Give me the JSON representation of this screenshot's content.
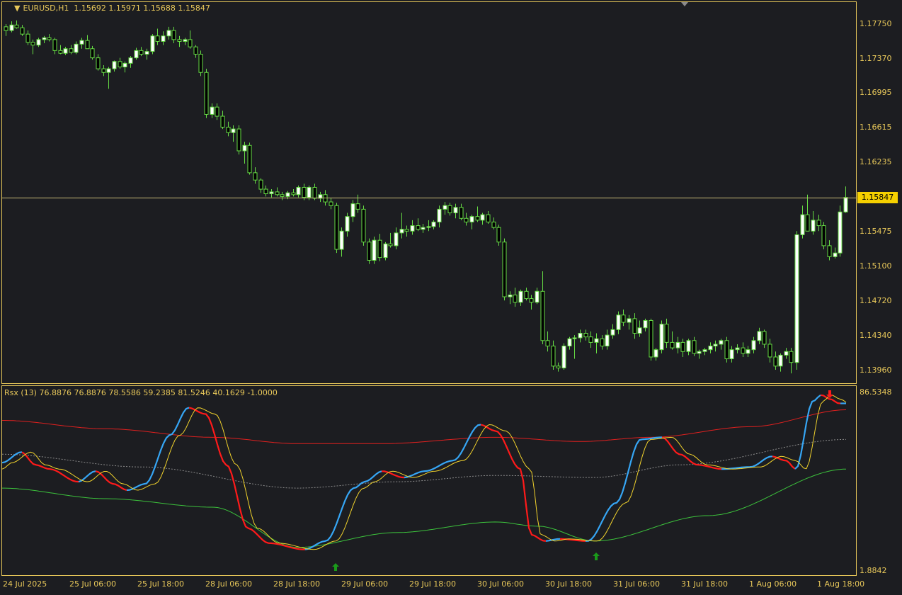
{
  "main": {
    "symbol_timeframe": "EURUSD,H1",
    "ohlc": "1.15692 1.15971 1.15688 1.15847",
    "price_labels": [
      "1.17750",
      "1.17370",
      "1.16995",
      "1.16615",
      "1.16235",
      "1.15475",
      "1.15100",
      "1.14720",
      "1.14340",
      "1.13960"
    ],
    "bid_price": "1.15847"
  },
  "indicator": {
    "title": "Rsx (13) 76.8876 76.8876 78.5586 59.2385 81.5246 40.1629 -1.0000",
    "scale_top": "86.5348",
    "scale_bottom": "1.8842"
  },
  "time_labels": [
    "24 Jul 2025",
    "25 Jul 06:00",
    "25 Jul 18:00",
    "28 Jul 06:00",
    "28 Jul 18:00",
    "29 Jul 06:00",
    "29 Jul 18:00",
    "30 Jul 06:00",
    "30 Jul 18:00",
    "31 Jul 06:00",
    "31 Jul 18:00",
    "1 Aug 06:00",
    "1 Aug 18:00"
  ],
  "colors": {
    "background": "#1c1d21",
    "frame": "#e8c85a",
    "candle": "#66dd44",
    "bull_fill": "#ffffff",
    "bear_fill": "#000000",
    "rsx_up": "#36a6f5",
    "rsx_down": "#ff1a1a",
    "signal": "#f2d32c",
    "upper_band": "#e0201f",
    "lower_band": "#3cc23c",
    "mid_band": "#8a8a8a",
    "arrow_up": "#1a9a1a",
    "arrow_down": "#ff1a1a"
  },
  "chart_data": {
    "type": "candlestick",
    "ylim": [
      1.1385,
      1.1795
    ],
    "y_ticks": [
      1.1775,
      1.1737,
      1.16995,
      1.16615,
      1.16235,
      1.15475,
      1.151,
      1.1472,
      1.1434,
      1.1396
    ],
    "candles": [
      [
        1.1772,
        1.1775,
        1.1762,
        1.1768
      ],
      [
        1.1768,
        1.1778,
        1.1766,
        1.1774
      ],
      [
        1.1774,
        1.1779,
        1.177,
        1.1771
      ],
      [
        1.1771,
        1.1774,
        1.1762,
        1.1764
      ],
      [
        1.1764,
        1.1768,
        1.1752,
        1.1755
      ],
      [
        1.1755,
        1.1758,
        1.1742,
        1.1752
      ],
      [
        1.1752,
        1.176,
        1.175,
        1.1758
      ],
      [
        1.1758,
        1.1762,
        1.1754,
        1.176
      ],
      [
        1.176,
        1.1764,
        1.1756,
        1.1758
      ],
      [
        1.1758,
        1.176,
        1.1742,
        1.1746
      ],
      [
        1.1746,
        1.1752,
        1.1742,
        1.1743
      ],
      [
        1.1743,
        1.175,
        1.1741,
        1.1748
      ],
      [
        1.1748,
        1.1752,
        1.1742,
        1.1744
      ],
      [
        1.1744,
        1.1756,
        1.1742,
        1.1753
      ],
      [
        1.1753,
        1.176,
        1.1748,
        1.1757
      ],
      [
        1.1757,
        1.1763,
        1.1752,
        1.1748
      ],
      [
        1.1748,
        1.1751,
        1.1736,
        1.1738
      ],
      [
        1.1738,
        1.1742,
        1.1724,
        1.1726
      ],
      [
        1.1726,
        1.173,
        1.1718,
        1.1722
      ],
      [
        1.1722,
        1.1728,
        1.1704,
        1.1726
      ],
      [
        1.1726,
        1.1735,
        1.1723,
        1.1734
      ],
      [
        1.1734,
        1.1738,
        1.1726,
        1.1728
      ],
      [
        1.1728,
        1.1734,
        1.1722,
        1.1732
      ],
      [
        1.1732,
        1.174,
        1.1727,
        1.1738
      ],
      [
        1.1738,
        1.1749,
        1.1736,
        1.1746
      ],
      [
        1.1746,
        1.175,
        1.174,
        1.1742
      ],
      [
        1.1742,
        1.1748,
        1.1736,
        1.1745
      ],
      [
        1.1745,
        1.1764,
        1.1742,
        1.1762
      ],
      [
        1.1762,
        1.177,
        1.1752,
        1.1756
      ],
      [
        1.1756,
        1.1767,
        1.1752,
        1.1762
      ],
      [
        1.1762,
        1.1772,
        1.1758,
        1.1768
      ],
      [
        1.1768,
        1.1772,
        1.1754,
        1.1758
      ],
      [
        1.1758,
        1.1762,
        1.175,
        1.1756
      ],
      [
        1.1756,
        1.176,
        1.1752,
        1.1758
      ],
      [
        1.1758,
        1.1768,
        1.1748,
        1.175
      ],
      [
        1.175,
        1.1752,
        1.1738,
        1.1742
      ],
      [
        1.1742,
        1.1746,
        1.1718,
        1.1722
      ],
      [
        1.1722,
        1.1726,
        1.1672,
        1.1676
      ],
      [
        1.1676,
        1.1688,
        1.1672,
        1.1684
      ],
      [
        1.1684,
        1.1688,
        1.167,
        1.1674
      ],
      [
        1.1674,
        1.168,
        1.166,
        1.1662
      ],
      [
        1.1662,
        1.1668,
        1.1652,
        1.1656
      ],
      [
        1.1656,
        1.1664,
        1.1646,
        1.166
      ],
      [
        1.166,
        1.1664,
        1.1632,
        1.1636
      ],
      [
        1.1636,
        1.1646,
        1.1622,
        1.1642
      ],
      [
        1.1642,
        1.1645,
        1.161,
        1.1612
      ],
      [
        1.1612,
        1.1618,
        1.16,
        1.1604
      ],
      [
        1.1604,
        1.1606,
        1.159,
        1.1594
      ],
      [
        1.1594,
        1.1598,
        1.1586,
        1.1589
      ],
      [
        1.1589,
        1.1594,
        1.1585,
        1.1591
      ],
      [
        1.1591,
        1.1596,
        1.1586,
        1.1588
      ],
      [
        1.1588,
        1.1591,
        1.1582,
        1.1586
      ],
      [
        1.1586,
        1.1592,
        1.1583,
        1.159
      ],
      [
        1.159,
        1.1594,
        1.1586,
        1.1588
      ],
      [
        1.1588,
        1.1598,
        1.1585,
        1.1596
      ],
      [
        1.1596,
        1.16,
        1.1582,
        1.1585
      ],
      [
        1.1585,
        1.1598,
        1.1582,
        1.1596
      ],
      [
        1.1596,
        1.16,
        1.1582,
        1.1584
      ],
      [
        1.1584,
        1.1591,
        1.158,
        1.1588
      ],
      [
        1.1588,
        1.1593,
        1.1576,
        1.158
      ],
      [
        1.158,
        1.1584,
        1.1572,
        1.1576
      ],
      [
        1.1576,
        1.1579,
        1.1524,
        1.1528
      ],
      [
        1.1528,
        1.1552,
        1.152,
        1.1548
      ],
      [
        1.1548,
        1.1568,
        1.1542,
        1.1564
      ],
      [
        1.1564,
        1.1582,
        1.1558,
        1.1578
      ],
      [
        1.1578,
        1.1588,
        1.1568,
        1.1572
      ],
      [
        1.1572,
        1.1576,
        1.1532,
        1.1536
      ],
      [
        1.1536,
        1.154,
        1.1512,
        1.1516
      ],
      [
        1.1516,
        1.1542,
        1.1512,
        1.1538
      ],
      [
        1.1538,
        1.1545,
        1.1515,
        1.1519
      ],
      [
        1.1519,
        1.1536,
        1.1516,
        1.1534
      ],
      [
        1.1534,
        1.1546,
        1.153,
        1.1532
      ],
      [
        1.1532,
        1.1552,
        1.1528,
        1.1546
      ],
      [
        1.1546,
        1.1568,
        1.154,
        1.155
      ],
      [
        1.155,
        1.1554,
        1.1542,
        1.1548
      ],
      [
        1.1548,
        1.156,
        1.1544,
        1.1554
      ],
      [
        1.1554,
        1.1562,
        1.1548,
        1.155
      ],
      [
        1.155,
        1.1556,
        1.1546,
        1.1552
      ],
      [
        1.1552,
        1.156,
        1.1548,
        1.1553
      ],
      [
        1.1553,
        1.156,
        1.155,
        1.1558
      ],
      [
        1.1558,
        1.1576,
        1.1552,
        1.1572
      ],
      [
        1.1572,
        1.158,
        1.1566,
        1.1576
      ],
      [
        1.1576,
        1.1579,
        1.1565,
        1.1568
      ],
      [
        1.1568,
        1.1578,
        1.1562,
        1.1574
      ],
      [
        1.1574,
        1.1578,
        1.156,
        1.1562
      ],
      [
        1.1562,
        1.1568,
        1.1554,
        1.1558
      ],
      [
        1.1558,
        1.1566,
        1.155,
        1.1564
      ],
      [
        1.1564,
        1.1575,
        1.1558,
        1.156
      ],
      [
        1.156,
        1.1568,
        1.1555,
        1.1566
      ],
      [
        1.1566,
        1.157,
        1.1556,
        1.1558
      ],
      [
        1.1558,
        1.1563,
        1.155,
        1.1552
      ],
      [
        1.1552,
        1.1555,
        1.1532,
        1.1536
      ],
      [
        1.1536,
        1.154,
        1.1472,
        1.1476
      ],
      [
        1.1476,
        1.1482,
        1.1468,
        1.1478
      ],
      [
        1.1478,
        1.1486,
        1.1465,
        1.147
      ],
      [
        1.147,
        1.1484,
        1.1466,
        1.1482
      ],
      [
        1.1482,
        1.1486,
        1.1472,
        1.1474
      ],
      [
        1.1474,
        1.1478,
        1.1462,
        1.147
      ],
      [
        1.147,
        1.1486,
        1.1468,
        1.1482
      ],
      [
        1.1482,
        1.1504,
        1.1424,
        1.1428
      ],
      [
        1.1428,
        1.1438,
        1.1416,
        1.1422
      ],
      [
        1.1422,
        1.1428,
        1.1396,
        1.14
      ],
      [
        1.14,
        1.1404,
        1.1394,
        1.1398
      ],
      [
        1.1398,
        1.1425,
        1.1396,
        1.1422
      ],
      [
        1.1422,
        1.1432,
        1.1418,
        1.143
      ],
      [
        1.143,
        1.1434,
        1.1408,
        1.1431
      ],
      [
        1.1431,
        1.144,
        1.1426,
        1.1436
      ],
      [
        1.1436,
        1.144,
        1.1428,
        1.1432
      ],
      [
        1.1432,
        1.1438,
        1.142,
        1.1426
      ],
      [
        1.1426,
        1.1436,
        1.1414,
        1.143
      ],
      [
        1.143,
        1.1434,
        1.1418,
        1.1422
      ],
      [
        1.1422,
        1.144,
        1.1418,
        1.1434
      ],
      [
        1.1434,
        1.1446,
        1.143,
        1.144
      ],
      [
        1.144,
        1.146,
        1.1435,
        1.1456
      ],
      [
        1.1456,
        1.1462,
        1.1444,
        1.1448
      ],
      [
        1.1448,
        1.1456,
        1.144,
        1.1452
      ],
      [
        1.1452,
        1.1458,
        1.143,
        1.1436
      ],
      [
        1.1436,
        1.145,
        1.1432,
        1.1442
      ],
      [
        1.1442,
        1.1452,
        1.1438,
        1.145
      ],
      [
        1.145,
        1.1452,
        1.1406,
        1.141
      ],
      [
        1.141,
        1.142,
        1.1406,
        1.1418
      ],
      [
        1.1418,
        1.145,
        1.1414,
        1.1446
      ],
      [
        1.1446,
        1.1452,
        1.142,
        1.1426
      ],
      [
        1.1426,
        1.1438,
        1.1418,
        1.142
      ],
      [
        1.142,
        1.1432,
        1.1414,
        1.1426
      ],
      [
        1.1426,
        1.143,
        1.141,
        1.1416
      ],
      [
        1.1416,
        1.143,
        1.1412,
        1.1428
      ],
      [
        1.1428,
        1.1432,
        1.1411,
        1.1414
      ],
      [
        1.1414,
        1.1418,
        1.1408,
        1.1416
      ],
      [
        1.1416,
        1.142,
        1.1412,
        1.1418
      ],
      [
        1.1418,
        1.1426,
        1.1414,
        1.1422
      ],
      [
        1.1422,
        1.1428,
        1.1416,
        1.1424
      ],
      [
        1.1424,
        1.143,
        1.1418,
        1.1428
      ],
      [
        1.1428,
        1.1432,
        1.1404,
        1.1408
      ],
      [
        1.1408,
        1.1422,
        1.1404,
        1.1418
      ],
      [
        1.1418,
        1.1424,
        1.1414,
        1.142
      ],
      [
        1.142,
        1.1426,
        1.141,
        1.1414
      ],
      [
        1.1414,
        1.1422,
        1.141,
        1.1418
      ],
      [
        1.1418,
        1.1432,
        1.1414,
        1.1428
      ],
      [
        1.1428,
        1.1442,
        1.1424,
        1.1438
      ],
      [
        1.1438,
        1.144,
        1.142,
        1.1424
      ],
      [
        1.1424,
        1.143,
        1.1404,
        1.141
      ],
      [
        1.141,
        1.1416,
        1.1396,
        1.14
      ],
      [
        1.14,
        1.1414,
        1.1394,
        1.1412
      ],
      [
        1.1412,
        1.142,
        1.1408,
        1.1416
      ],
      [
        1.1416,
        1.142,
        1.1392,
        1.1404
      ],
      [
        1.1404,
        1.1548,
        1.1396,
        1.1544
      ],
      [
        1.1544,
        1.1576,
        1.154,
        1.1566
      ],
      [
        1.1566,
        1.1588,
        1.1554,
        1.1548
      ],
      [
        1.1548,
        1.157,
        1.1544,
        1.156
      ],
      [
        1.156,
        1.1566,
        1.1548,
        1.1554
      ],
      [
        1.1554,
        1.1558,
        1.1528,
        1.1532
      ],
      [
        1.1532,
        1.1538,
        1.1516,
        1.152
      ],
      [
        1.152,
        1.153,
        1.1518,
        1.1524
      ],
      [
        1.1524,
        1.1576,
        1.152,
        1.1569
      ],
      [
        1.1569,
        1.1597,
        1.1568,
        1.1585
      ]
    ],
    "indicator_ylim": [
      1.8842,
      86.5348
    ]
  }
}
